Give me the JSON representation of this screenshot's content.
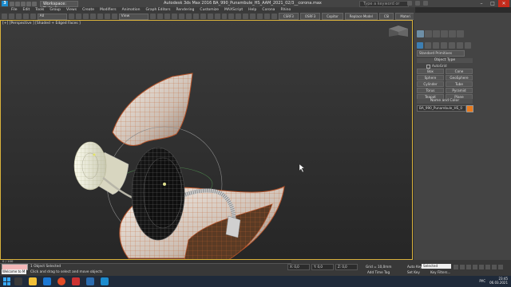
{
  "titlebar": {
    "workspace": "Workspace: Default",
    "title": "Autodesk 3ds Max 2016    BA_990_Punambule_HS_AAM_2021_02/3__corona.max",
    "search_placeholder": "Type a keyword or phrase"
  },
  "menu": [
    "File",
    "Edit",
    "Tools",
    "Group",
    "Views",
    "Create",
    "Modifiers",
    "Animation",
    "Graph Editors",
    "Rendering",
    "Customize",
    "MAXScript",
    "Help",
    "Corona",
    "Rhino"
  ],
  "toolbar": {
    "selection_filter": "All",
    "view_dropdown": "View",
    "buttons": [
      "CSRF3",
      "OSRF3",
      "Copitor",
      "Replace Model",
      "CSI",
      "Materi"
    ]
  },
  "viewport": {
    "label": "[+] [Perspective ] [Shaded + Edged Faces ]"
  },
  "command_panel": {
    "primitive_type": "Standard Primitives",
    "object_type_header": "Object Type",
    "autogrid_label": "AutoGrid",
    "objects": [
      "Box",
      "Cone",
      "Sphere",
      "GeoSphere",
      "Cylinder",
      "Tube",
      "Torus",
      "Pyramid",
      "Teapot",
      "Plane"
    ],
    "name_color_header": "Name and Color",
    "name_value": "BA_990_Punambule_HS_0",
    "swatch_color": "#e87a1d"
  },
  "status": {
    "frame_counter": "0 / 100",
    "welcome": "Welcome to M",
    "selection": "1 Object Selected",
    "hint": "Click and drag to select and move objects",
    "x": "X: 0,0",
    "y": "Y: 0,0",
    "z": "Z: 0,0",
    "grid": "Grid = 10,0mm",
    "add_time_tag": "Add Time Tag",
    "auto_key": "Auto Key",
    "set_key": "Set Key",
    "selected": "Selected",
    "key_filters": "Key Filters..."
  },
  "taskbar": {
    "language": "РУС",
    "time": "23:45",
    "date": "06.03.2021"
  }
}
